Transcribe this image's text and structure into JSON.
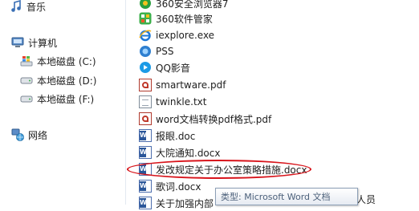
{
  "nav": {
    "music": "音乐",
    "computer": "计算机",
    "drive_c": "本地磁盘 (C:)",
    "drive_d": "本地磁盘 (D:)",
    "drive_f": "本地磁盘 (F:)",
    "network": "网络"
  },
  "files": [
    {
      "name": "360安全浏览器7",
      "icon": "360-browser-icon"
    },
    {
      "name": "360软件管家",
      "icon": "360-manager-icon"
    },
    {
      "name": "iexplore.exe",
      "icon": "ie-icon"
    },
    {
      "name": "PSS",
      "icon": "pss-icon"
    },
    {
      "name": "QQ影音",
      "icon": "qq-player-icon"
    },
    {
      "name": "smartware.pdf",
      "icon": "pdf-icon"
    },
    {
      "name": "twinkle.txt",
      "icon": "txt-icon"
    },
    {
      "name": "word文档转换pdf格式.pdf",
      "icon": "pdf-icon"
    },
    {
      "name": "报眼.doc",
      "icon": "word-icon"
    },
    {
      "name": "大院通知.docx",
      "icon": "word-icon"
    },
    {
      "name": "发改规定关于办公室策略措施.docx",
      "icon": "word-icon"
    },
    {
      "name": "歌词.docx",
      "icon": "word-icon"
    },
    {
      "name": "关于加强内部",
      "icon": "word-icon"
    }
  ],
  "tooltip": {
    "text": "类型: Microsoft Word 文档"
  },
  "clipped_text": "加人员",
  "colors": {
    "highlight": "#d8141b",
    "selection": "#cde8ff"
  }
}
